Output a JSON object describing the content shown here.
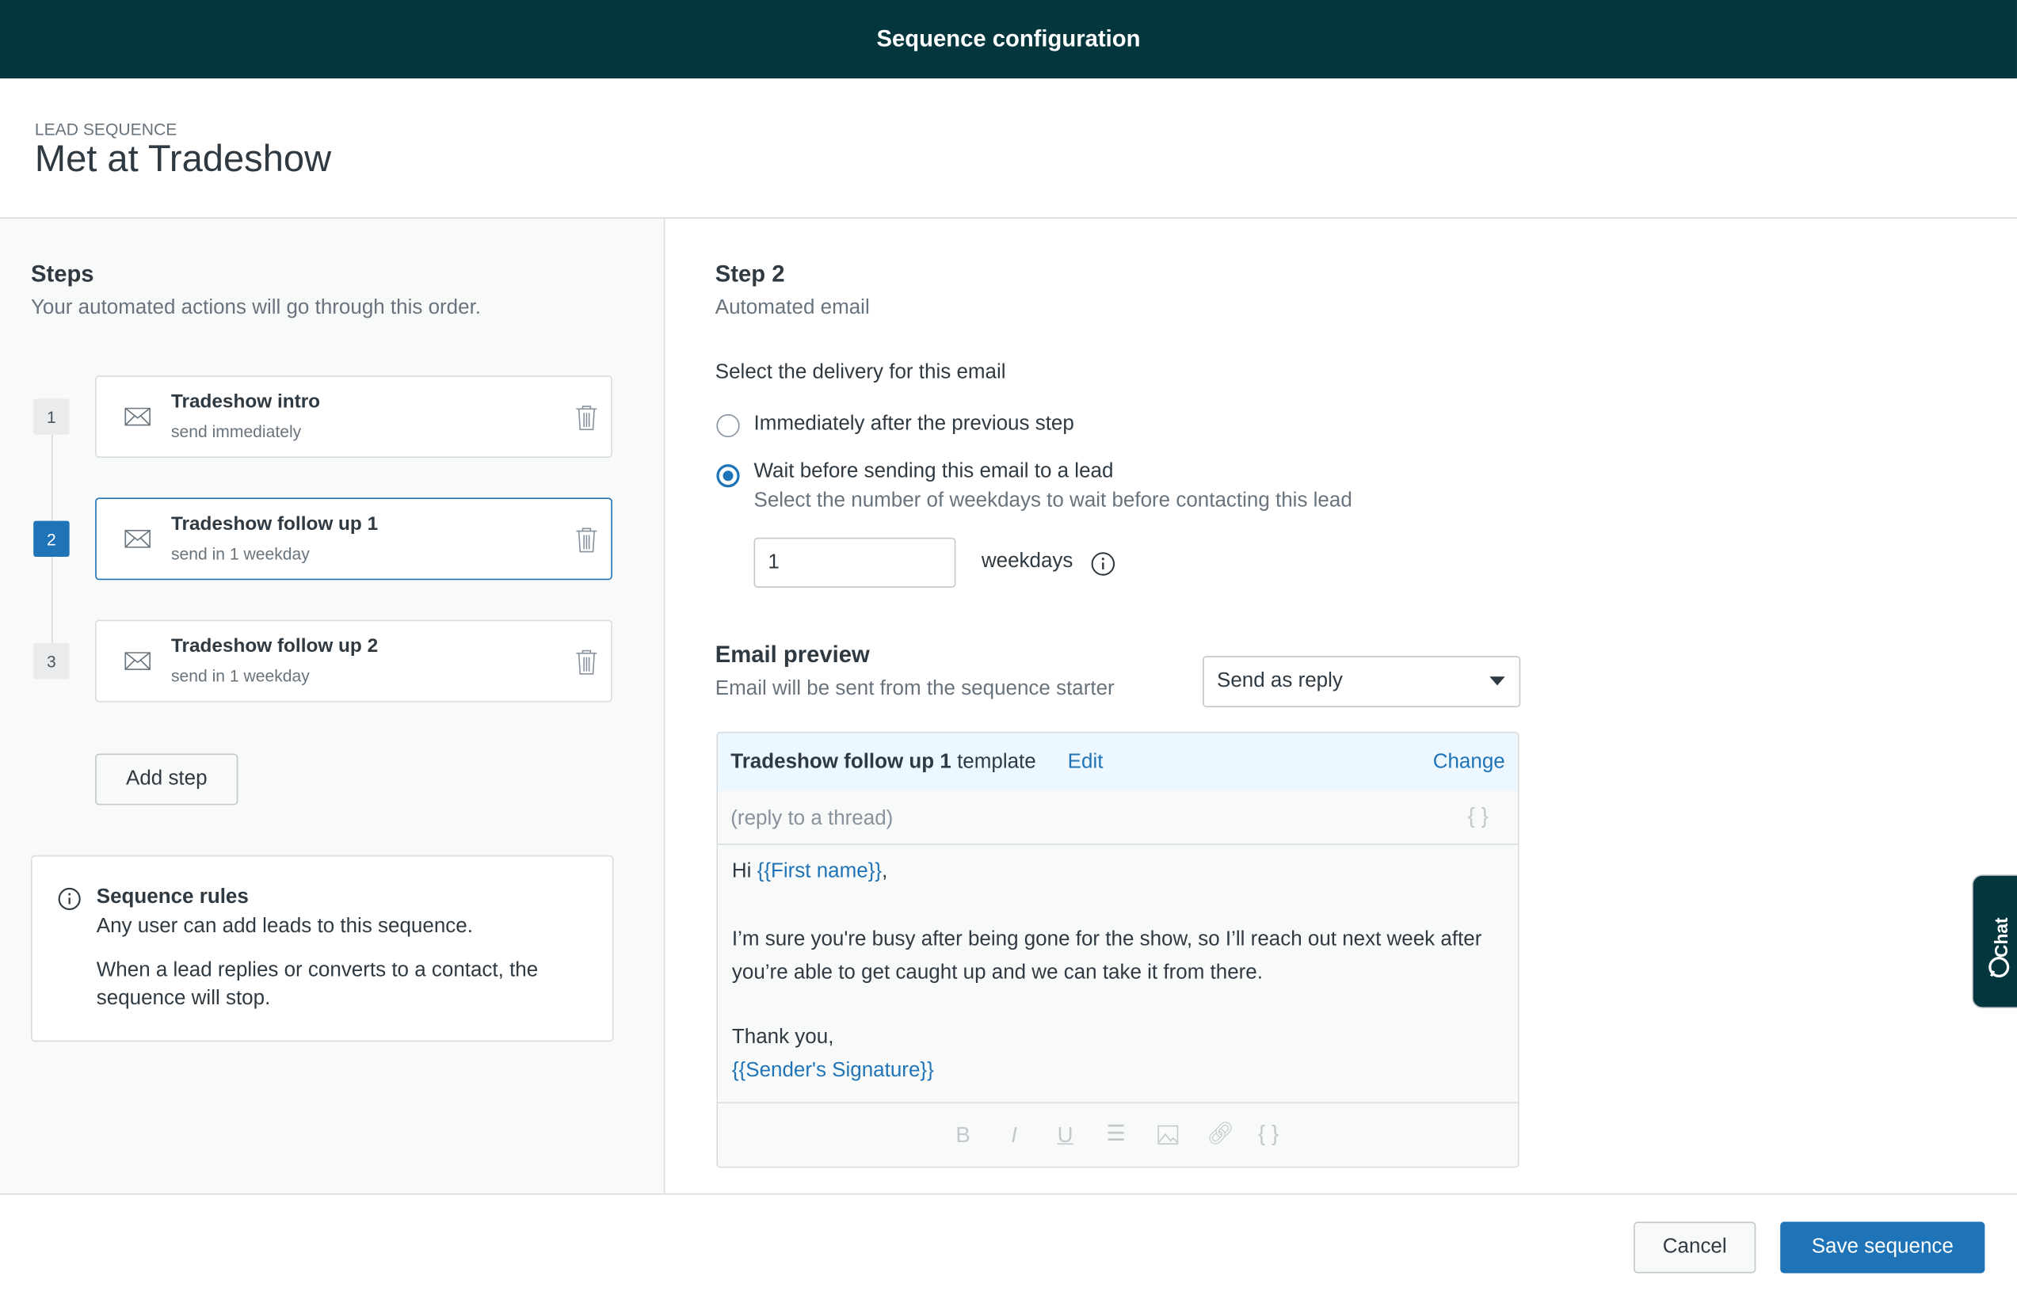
{
  "topbar": {
    "title": "Sequence configuration"
  },
  "header": {
    "eyebrow": "LEAD SEQUENCE",
    "title": "Met at Tradeshow"
  },
  "steps_panel": {
    "title": "Steps",
    "subtitle": "Your automated actions will go through this order.",
    "steps": [
      {
        "number": "1",
        "title": "Tradeshow intro",
        "subtitle": "send immediately",
        "selected": false
      },
      {
        "number": "2",
        "title": "Tradeshow follow up 1",
        "subtitle": "send in 1 weekday",
        "selected": true
      },
      {
        "number": "3",
        "title": "Tradeshow follow up 2",
        "subtitle": "send in 1 weekday",
        "selected": false
      }
    ],
    "add_step_label": "Add step",
    "rules": {
      "title": "Sequence rules",
      "line1": "Any user can add leads to this sequence.",
      "line2": "When a lead replies or converts to a contact, the sequence will stop."
    }
  },
  "detail": {
    "title": "Step 2",
    "subtitle": "Automated email",
    "delivery_label": "Select the delivery for this email",
    "option_immediate": "Immediately after the previous step",
    "option_wait": "Wait before sending this email to a lead",
    "option_wait_help": "Select the number of weekdays to wait before contacting this lead",
    "selected_option": "wait",
    "weekdays_value": "1",
    "weekdays_label": "weekdays",
    "preview_title": "Email preview",
    "preview_subtitle": "Email will be sent from the sequence starter",
    "send_mode": "Send as reply",
    "template_name": "Tradeshow follow up 1",
    "template_word": "template",
    "edit_label": "Edit",
    "change_label": "Change",
    "subject_placeholder": "(reply to a thread)",
    "body": {
      "greeting": "Hi ",
      "first_name": "{{First name}}",
      "comma": ",",
      "paragraph": "I’m sure you're busy after being gone for the show, so I’ll reach out next week after you’re able to get caught up and we can take it from there.",
      "thanks": "Thank you,",
      "signature": "{{Sender's Signature}}"
    },
    "toolbar": [
      "bold",
      "italic",
      "underline",
      "list",
      "image",
      "link",
      "placeholder"
    ]
  },
  "footer": {
    "cancel_label": "Cancel",
    "save_label": "Save sequence"
  },
  "chat": {
    "label": "Chat"
  },
  "colors": {
    "topbar": "#03363d",
    "accent": "#1f73b7"
  }
}
